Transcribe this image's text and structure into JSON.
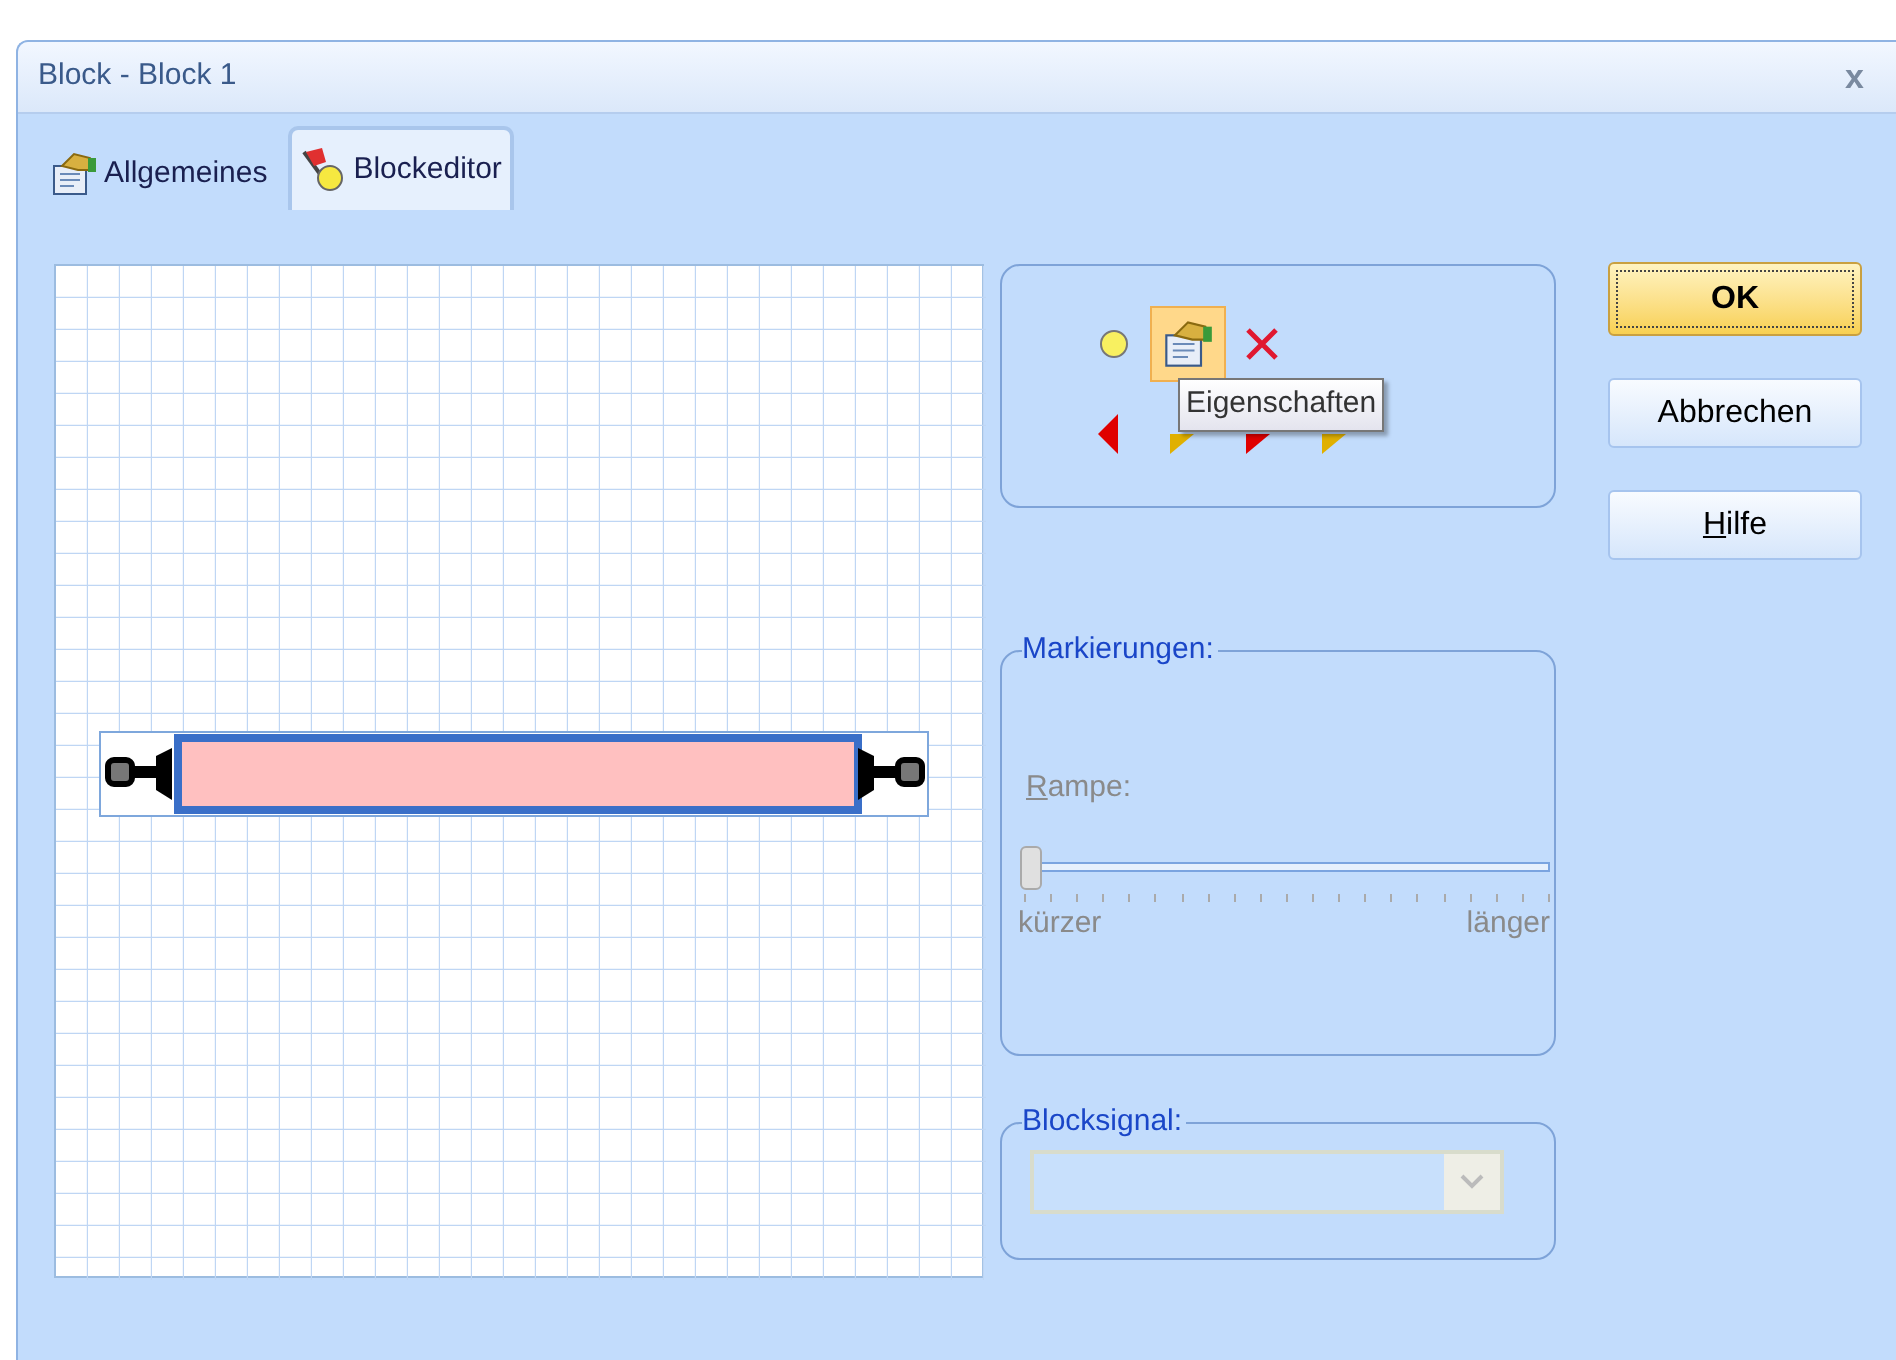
{
  "window": {
    "title": "Block - Block 1",
    "close": "x"
  },
  "tabs": [
    {
      "label": "Allgemeines",
      "selected": false,
      "kind": "properties"
    },
    {
      "label": "Blockeditor",
      "selected": true,
      "kind": "flag"
    }
  ],
  "toolbox": {
    "tools": [
      {
        "kind": "circle",
        "highlighted": false
      },
      {
        "kind": "properties",
        "highlighted": true
      },
      {
        "kind": "delete",
        "highlighted": false
      }
    ],
    "markers": [
      {
        "kind": "arrow",
        "color": "#e00000"
      },
      {
        "kind": "flag",
        "color": "#e0b000"
      },
      {
        "kind": "flag",
        "color": "#e00000"
      },
      {
        "kind": "flag",
        "color": "#e0b000"
      }
    ],
    "tooltip": "Eigenschaften"
  },
  "markings": {
    "title": "Markierungen:",
    "label": "Rampe:",
    "slider": {
      "level": 0,
      "disabled": true
    },
    "min_label": "kürzer",
    "max_label": "länger"
  },
  "block_signal": {
    "title": "Blocksignal:",
    "combo": {
      "disabled": true
    }
  },
  "buttons": [
    {
      "label": "OK",
      "default": true
    },
    {
      "label": "Abbrechen",
      "default": false
    },
    {
      "label": "Hilfe",
      "default": false
    }
  ]
}
